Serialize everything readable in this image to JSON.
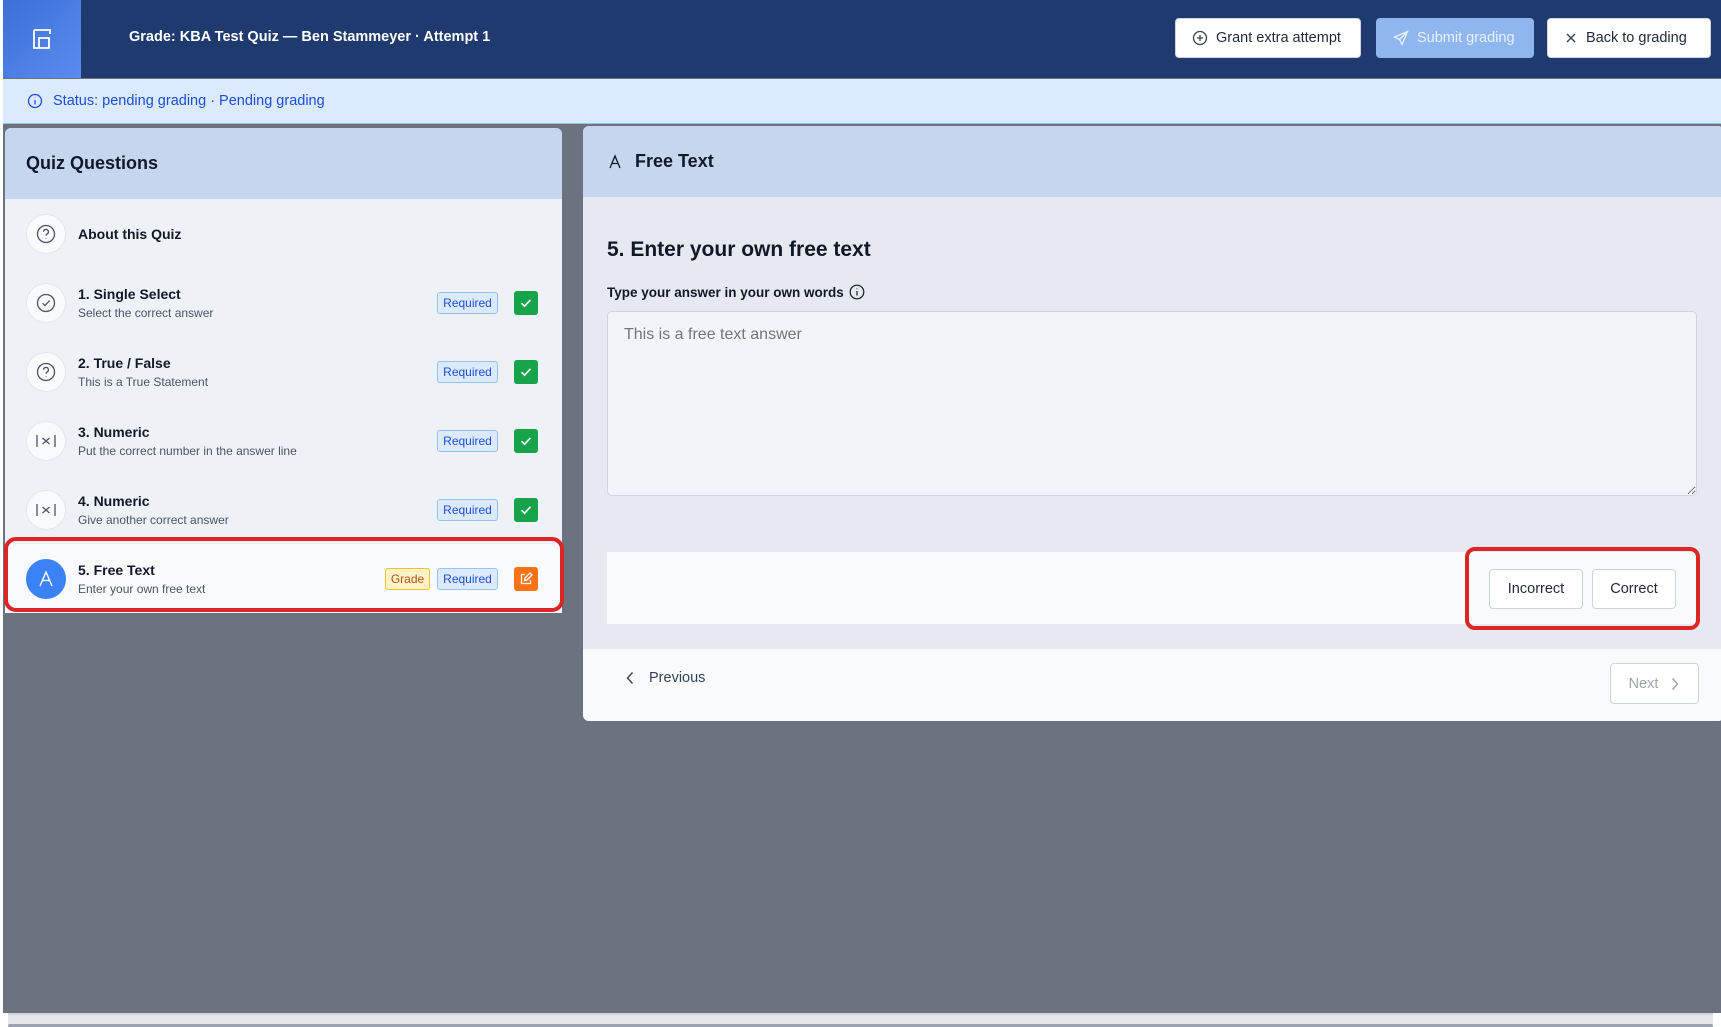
{
  "header": {
    "logo_icon": "quiz-logo-icon",
    "title": "Grade: KBA Test Quiz — Ben Stammeyer · Attempt 1",
    "grant_label": "Grant extra attempt",
    "submit_label": "Submit grading",
    "back_label": "Back to grading"
  },
  "status": {
    "text": "Status: pending grading · Pending grading"
  },
  "sidebar": {
    "heading": "Quiz Questions",
    "items": [
      {
        "title": "About this Quiz",
        "subtitle": "",
        "icon": "question-circle-icon"
      },
      {
        "title": "1. Single Select",
        "subtitle": "Select the correct answer",
        "badge": "Required",
        "state": "check"
      },
      {
        "title": "2. True / False",
        "subtitle": "This is a True Statement",
        "badge": "Required",
        "state": "check"
      },
      {
        "title": "3. Numeric",
        "subtitle": "Put the correct number in the answer line",
        "badge": "Required",
        "state": "check"
      },
      {
        "title": "4. Numeric",
        "subtitle": "Give another correct answer",
        "badge": "Required",
        "state": "check"
      },
      {
        "title": "5. Free Text",
        "subtitle": "Enter your own free text",
        "grade_badge": "Grade",
        "badge": "Required",
        "state": "edit"
      }
    ]
  },
  "main": {
    "section_title": "Free Text",
    "question": "5. Enter your own free text",
    "label": "Type your answer in your own words",
    "answer_placeholder": "This is a free text answer",
    "incorrect_label": "Incorrect",
    "correct_label": "Correct",
    "previous_label": "Previous",
    "next_label": "Next"
  },
  "colors": {
    "header_bg": "#1e3a6e",
    "accent": "#3b82f6",
    "success": "#16a34a",
    "warning": "#f97316",
    "highlight": "#dc2626"
  }
}
